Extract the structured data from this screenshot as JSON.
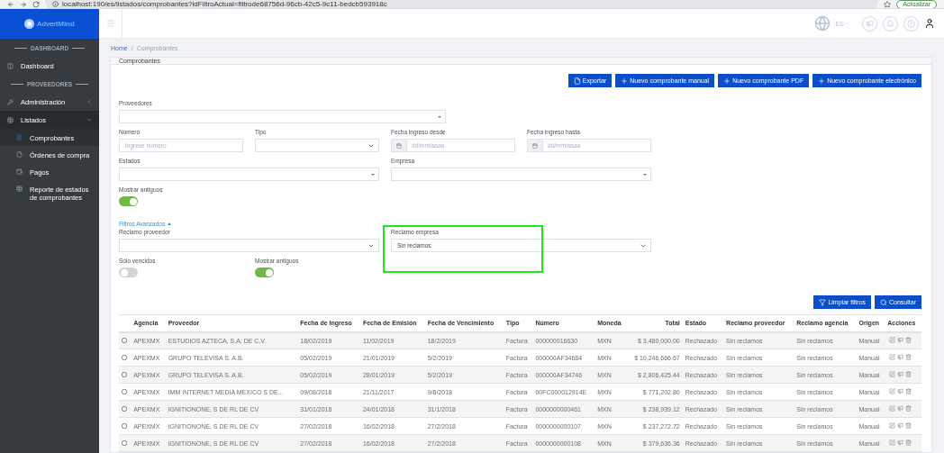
{
  "browser": {
    "url": "localhost:190/es/listados/comprobantes?idFiltroActual=filtrode68756d-96cb-42c5-9c11-bedcb593918c",
    "update_button": "Actualizar"
  },
  "sidebar": {
    "logo": {
      "first": "Advert",
      "second": "Mind"
    },
    "items": [
      {
        "kind": "heading",
        "label": "DASHBOARD"
      },
      {
        "kind": "item",
        "label": "Dashboard",
        "selected": false
      },
      {
        "kind": "heading",
        "label": "PROVEEDORES"
      },
      {
        "kind": "group",
        "label": "Administración",
        "expanded": false
      },
      {
        "kind": "group",
        "label": "Listados",
        "expanded": true,
        "children": [
          {
            "label": "Comprobantes",
            "selected": true
          },
          {
            "label": "Órdenes de compra",
            "selected": false
          },
          {
            "label": "Pagos",
            "selected": false
          },
          {
            "label": "Reporte de estados de comprobantes",
            "selected": false
          }
        ]
      }
    ]
  },
  "header": {
    "language": "ES"
  },
  "breadcrumb": {
    "separator": "/",
    "items": [
      "Home",
      "Comprobantes"
    ]
  },
  "card": {
    "title": "Comprobantes",
    "actions": [
      {
        "kind": "export",
        "label": "Exportar"
      },
      {
        "kind": "add",
        "label": "Nuevo comprobante manual"
      },
      {
        "kind": "add",
        "label": "Nuevo comprobante PDF"
      },
      {
        "kind": "add",
        "label": "Nuevo comprobante electrónico"
      }
    ],
    "filter_rows": [
      [
        {
          "kind": "multiselect",
          "label": "Proveedores"
        }
      ],
      [
        {
          "kind": "input",
          "label": "Número",
          "placeholder": "Ingrese número"
        },
        {
          "kind": "select",
          "label": "Tipo"
        },
        {
          "kind": "date",
          "label": "Fecha ingreso desde",
          "placeholder": "dd/mm/aaaa"
        },
        {
          "kind": "date",
          "label": "Fecha ingreso hasta",
          "placeholder": "dd/mm/aaaa"
        }
      ],
      [
        {
          "kind": "multiselect",
          "label": "Estados"
        },
        {
          "kind": "multiselect",
          "label": "Empresa"
        }
      ],
      [
        {
          "kind": "toggle",
          "label": "Mostrar antiguos",
          "on": true
        }
      ]
    ],
    "advanced": {
      "label": "Filtros Avanzados",
      "expanded": true,
      "rows": [
        [
          {
            "kind": "select",
            "label": "Reclamo proveedor",
            "highlighted": false
          },
          {
            "kind": "select",
            "label": "Reclamo empresa",
            "value": "Sin reclamos",
            "highlighted": true
          }
        ],
        [
          {
            "kind": "toggle",
            "label": "Sólo vencidos",
            "on": false
          },
          {
            "kind": "toggle",
            "label": "Mostrar antiguos",
            "on": true
          }
        ]
      ]
    },
    "search_actions": [
      {
        "kind": "clear",
        "label": "Limpiar filtros"
      },
      {
        "kind": "search",
        "label": "Consultar"
      }
    ],
    "table": {
      "columns": [
        "Agencia",
        "Proveedor",
        "Fecha de Ingreso",
        "Fecha de Emisión",
        "Fecha de Vencimiento",
        "Tipo",
        "Número",
        "Moneda",
        "Total",
        "Estado",
        "Reclamo proveedor",
        "Reclamo agencia",
        "Origen",
        "Acciones"
      ],
      "rows": [
        {
          "checked": false,
          "cells": [
            "APEXMX",
            "ESTUDIOS AZTECA, S.A. DE C.V.",
            "18/02/2019",
            "11/02/2019",
            "18/2/2019",
            "Factura",
            "000000016630",
            "MXN",
            "$ 3,480,000.00",
            "Rechazado",
            "Sin reclamos",
            "Sin reclamos",
            "Manual"
          ]
        },
        {
          "checked": false,
          "cells": [
            "APEXMX",
            "GRUPO TELEVISA S. A.B.",
            "05/02/2019",
            "21/01/2019",
            "5/2/2019",
            "Factura",
            "000000AF34684",
            "MXN",
            "$ 10,246,666.67",
            "Rechazado",
            "Sin reclamos",
            "Sin reclamos",
            "Manual"
          ]
        },
        {
          "checked": false,
          "cells": [
            "APEXMX",
            "GRUPO TELEVISA S. A.B.",
            "05/02/2019",
            "28/01/2019",
            "5/2/2019",
            "Factura",
            "000000AF34746",
            "MXN",
            "$ 2,806,425.44",
            "Rechazado",
            "Sin reclamos",
            "Sin reclamos",
            "Manual"
          ]
        },
        {
          "checked": false,
          "cells": [
            "APEXMX",
            "IMM INTERNET MEDIA MEXICO S DE...",
            "09/08/2018",
            "21/11/2017",
            "9/8/2018",
            "Factura",
            "00FC000012914E",
            "MXN",
            "$ 771,202.80",
            "Rechazado",
            "Sin reclamos",
            "Sin reclamos",
            "Manual"
          ]
        },
        {
          "checked": false,
          "cells": [
            "APEXMX",
            "IGNITIONONE, S DE RL DE CV",
            "31/01/2018",
            "24/01/2018",
            "31/1/2018",
            "Factura",
            "0000000000461",
            "MXN",
            "$ 238,939.12",
            "Rechazado",
            "Sin reclamos",
            "Sin reclamos",
            "Manual"
          ]
        },
        {
          "checked": false,
          "cells": [
            "APEXMX",
            "IGNITIONONE, S DE RL DE CV",
            "27/02/2018",
            "16/02/2018",
            "27/2/2018",
            "Factura",
            "0000000000107",
            "MXN",
            "$ 237,272.72",
            "Rechazado",
            "Sin reclamos",
            "Sin reclamos",
            "Manual"
          ]
        },
        {
          "checked": false,
          "cells": [
            "APEXMX",
            "IGNITIONONE, S DE RL DE CV",
            "27/02/2018",
            "16/02/2018",
            "27/2/2018",
            "Factura",
            "0000000000108",
            "MXN",
            "$ 379,636.36",
            "Rechazado",
            "Sin reclamos",
            "Sin reclamos",
            "Manual"
          ]
        }
      ]
    }
  }
}
